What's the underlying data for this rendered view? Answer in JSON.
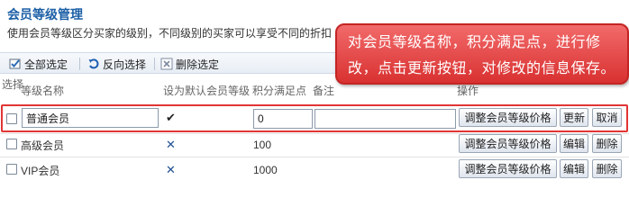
{
  "page": {
    "title": "会员等级管理",
    "description": "使用会员等级区分买家的级别，不同级别的买家可以享受不同的折扣"
  },
  "toolbar": {
    "select_all": "全部选定",
    "invert_select": "反向选择",
    "delete_selected": "删除选定"
  },
  "table": {
    "headers": {
      "select": "选择",
      "level_name": "等级名称",
      "set_default": "设为默认会员等级",
      "points": "积分满足点",
      "remark": "备注",
      "actions": "操作"
    },
    "edit_row": {
      "name_value": "普通会员",
      "is_default": true,
      "points_value": "0",
      "remark_value": "",
      "adjust_label": "调整会员等级价格",
      "update_label": "更新",
      "cancel_label": "取消"
    },
    "rows": [
      {
        "name": "高级会员",
        "is_default": false,
        "points": "100",
        "adjust_label": "调整会员等级价格",
        "edit_label": "编辑",
        "delete_label": "删除"
      },
      {
        "name": "VIP会员",
        "is_default": false,
        "points": "1000",
        "adjust_label": "调整会员等级价格",
        "edit_label": "编辑",
        "delete_label": "删除"
      }
    ]
  },
  "callout": {
    "line1": "对会员等级名称，积分满足点，进行修",
    "line2": "改，点击更新按钮，对修改的信息保存。",
    "color": "#e04444"
  },
  "symbols": {
    "check": "✔",
    "cross": "✕"
  }
}
